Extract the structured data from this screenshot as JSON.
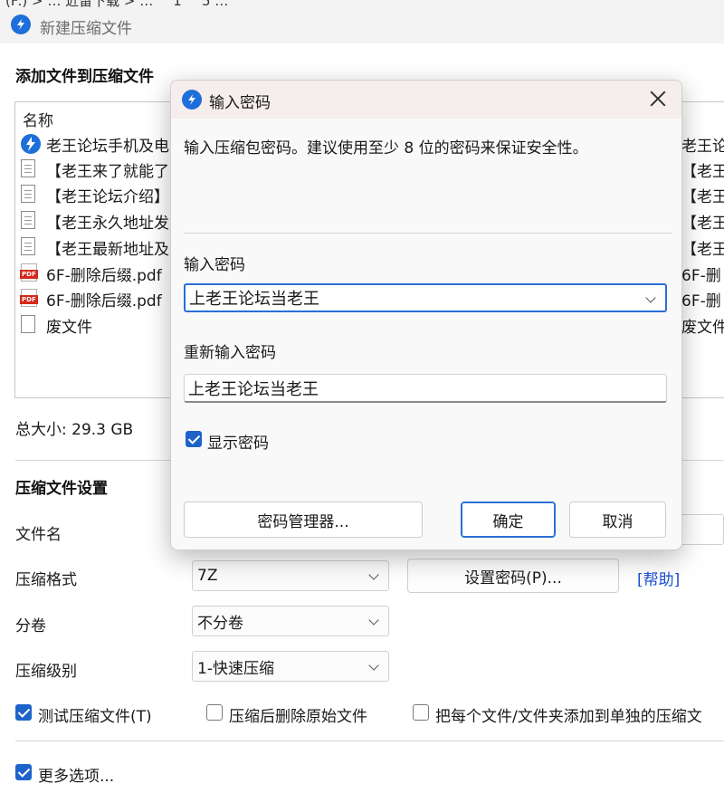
{
  "top_strip_text": "(F:)  >  …  近留下载  >  …  ^ 1 ^ 5 …",
  "window": {
    "title": "新建压缩文件"
  },
  "files_section": {
    "title": "添加文件到压缩文件",
    "column_name": "名称",
    "rows": [
      {
        "icon": "zip-archive-icon",
        "name": "老王论坛手机及电",
        "right": "老王论"
      },
      {
        "icon": "document-icon",
        "name": "【老王来了就能了",
        "right": "【老王"
      },
      {
        "icon": "document-icon",
        "name": "【老王论坛介绍】",
        "right": "【老王"
      },
      {
        "icon": "document-icon",
        "name": "【老王永久地址发",
        "right": "【老王"
      },
      {
        "icon": "document-icon",
        "name": "【老王最新地址及",
        "right": "【老王"
      },
      {
        "icon": "pdf-icon",
        "name": "6F-删除后缀.pdf",
        "right": "6F-删"
      },
      {
        "icon": "pdf-icon",
        "name": "6F-删除后缀.pdf",
        "right": "6F-删"
      },
      {
        "icon": "blank-file-icon",
        "name": "废文件",
        "right": "废文件"
      }
    ],
    "total_size": "总大小: 29.3 GB"
  },
  "settings": {
    "title": "压缩文件设置",
    "filename_label": "文件名",
    "format_label": "压缩格式",
    "format_value": "7Z",
    "set_password_button": "设置密码(P)...",
    "help_link": "[帮助]",
    "volume_label": "分卷",
    "volume_value": "不分卷",
    "level_label": "压缩级别",
    "level_value": "1-快速压缩",
    "test_checkbox": "测试压缩文件(T)",
    "delete_checkbox": "压缩后删除原始文件",
    "separate_checkbox": "把每个文件/文件夹添加到单独的压缩文",
    "more_options": "更多选项..."
  },
  "dialog": {
    "title": "输入密码",
    "description": "输入压缩包密码。建议使用至少 8 位的密码来保证安全性。",
    "password_label": "输入密码",
    "password_value": "上老王论坛当老王",
    "confirm_label": "重新输入密码",
    "confirm_value": "上老王论坛当老王",
    "show_password": "显示密码",
    "manager_button": "密码管理器...",
    "ok_button": "确定",
    "cancel_button": "取消"
  },
  "colors": {
    "accent": "#1e63c9",
    "link": "#1b4fd1",
    "dialog_titlebar": "#f6eded"
  }
}
